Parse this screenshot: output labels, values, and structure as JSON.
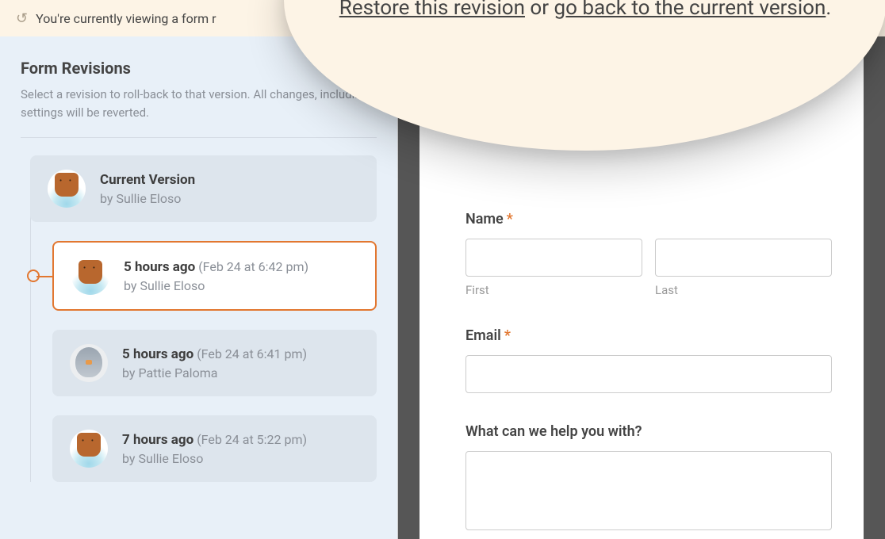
{
  "banner": {
    "text": "You're currently viewing a form r"
  },
  "zoom": {
    "restore_link": "Restore this revision",
    "or_text": " or ",
    "goback_link": "go back to the current version",
    "period": "."
  },
  "sidebar": {
    "title": "Form Revisions",
    "description": "Select a revision to roll-back to that version. All changes, including settings will be reverted."
  },
  "revisions": [
    {
      "title": "Current Version",
      "time": "",
      "author": "by Sullie Eloso",
      "avatar": "bear",
      "selected": false,
      "indent": false
    },
    {
      "title": "5 hours ago",
      "time": "(Feb 24 at 6:42 pm)",
      "author": "by Sullie Eloso",
      "avatar": "bear",
      "selected": true,
      "indent": true
    },
    {
      "title": "5 hours ago",
      "time": "(Feb 24 at 6:41 pm)",
      "author": "by Pattie Paloma",
      "avatar": "bird",
      "selected": false,
      "indent": true
    },
    {
      "title": "7 hours ago",
      "time": "(Feb 24 at 5:22 pm)",
      "author": "by Sullie Eloso",
      "avatar": "bear",
      "selected": false,
      "indent": true
    }
  ],
  "form": {
    "name_label": "Name",
    "first_label": "First",
    "last_label": "Last",
    "email_label": "Email",
    "message_label": "What can we help you with?"
  }
}
